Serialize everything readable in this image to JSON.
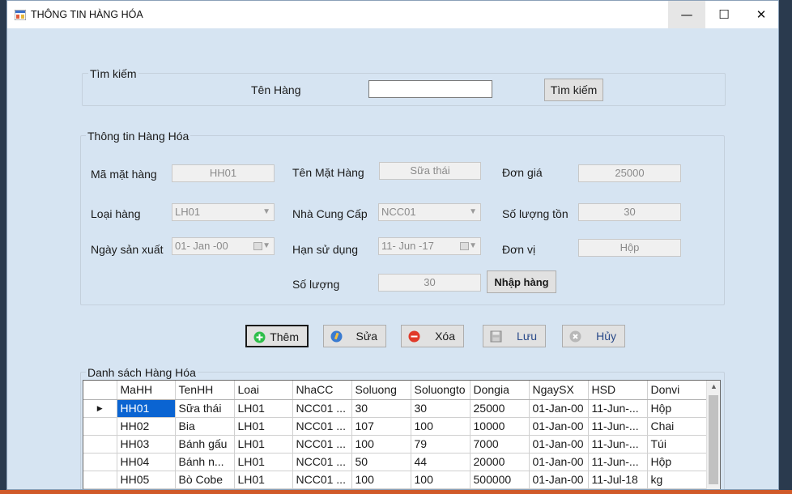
{
  "window": {
    "title": "THÔNG TIN HÀNG HÓA"
  },
  "search": {
    "group_title": "Tìm kiếm",
    "label": "Tên Hàng",
    "value": "",
    "button": "Tìm kiếm"
  },
  "info": {
    "group_title": "Thông tin Hàng Hóa",
    "ma_label": "Mã mặt hàng",
    "ma_value": "HH01",
    "ten_label": "Tên Mặt Hàng",
    "ten_value": "Sữa thái",
    "dongia_label": "Đơn giá",
    "dongia_value": "25000",
    "loai_label": "Loại hàng",
    "loai_value": "LH01",
    "ncc_label": "Nhà Cung Cấp",
    "ncc_value": "NCC01",
    "slton_label": "Số lượng tồn",
    "slton_value": "30",
    "nsx_label": "Ngày sản xuất",
    "nsx_value": "01- Jan -00",
    "hsd_label": "Hạn sử dụng",
    "hsd_value": "11- Jun -17",
    "donvi_label": "Đơn vị",
    "donvi_value": "Hộp",
    "sl_label": "Số lượng",
    "sl_value": "30",
    "nhap_button": "Nhập hàng"
  },
  "actions": {
    "them": "Thêm",
    "sua": "Sửa",
    "xoa": "Xóa",
    "luu": "Lưu",
    "huy": "Hủy"
  },
  "list": {
    "title": "Danh sách Hàng Hóa",
    "columns": [
      "MaHH",
      "TenHH",
      "Loai",
      "NhaCC",
      "Soluong",
      "Soluongto",
      "Dongia",
      "NgaySX",
      "HSD",
      "Donvi"
    ],
    "rows": [
      [
        "HH01",
        "Sữa thái",
        "LH01",
        "NCC01 ...",
        "30",
        "30",
        "25000",
        "01-Jan-00",
        "11-Jun-...",
        "Hộp"
      ],
      [
        "HH02",
        "Bia",
        "LH01",
        "NCC01 ...",
        "107",
        "100",
        "10000",
        "01-Jan-00",
        "11-Jun-...",
        "Chai"
      ],
      [
        "HH03",
        "Bánh gấu",
        "LH01",
        "NCC01 ...",
        "100",
        "79",
        "7000",
        "01-Jan-00",
        "11-Jun-...",
        "Túi"
      ],
      [
        "HH04",
        "Bánh n...",
        "LH01",
        "NCC01 ...",
        "50",
        "44",
        "20000",
        "01-Jan-00",
        "11-Jun-...",
        "Hộp"
      ],
      [
        "HH05",
        "Bò Cobe",
        "LH01",
        "NCC01 ...",
        "100",
        "100",
        "500000",
        "01-Jan-00",
        "11-Jul-18",
        "kg"
      ]
    ]
  },
  "colors": {
    "form_bg": "#d6e4f2",
    "selection": "#0a64d2",
    "add_icon": "#2fbf4a",
    "delete_icon": "#e03a2a",
    "edit_icon": "#3b7bd0"
  }
}
